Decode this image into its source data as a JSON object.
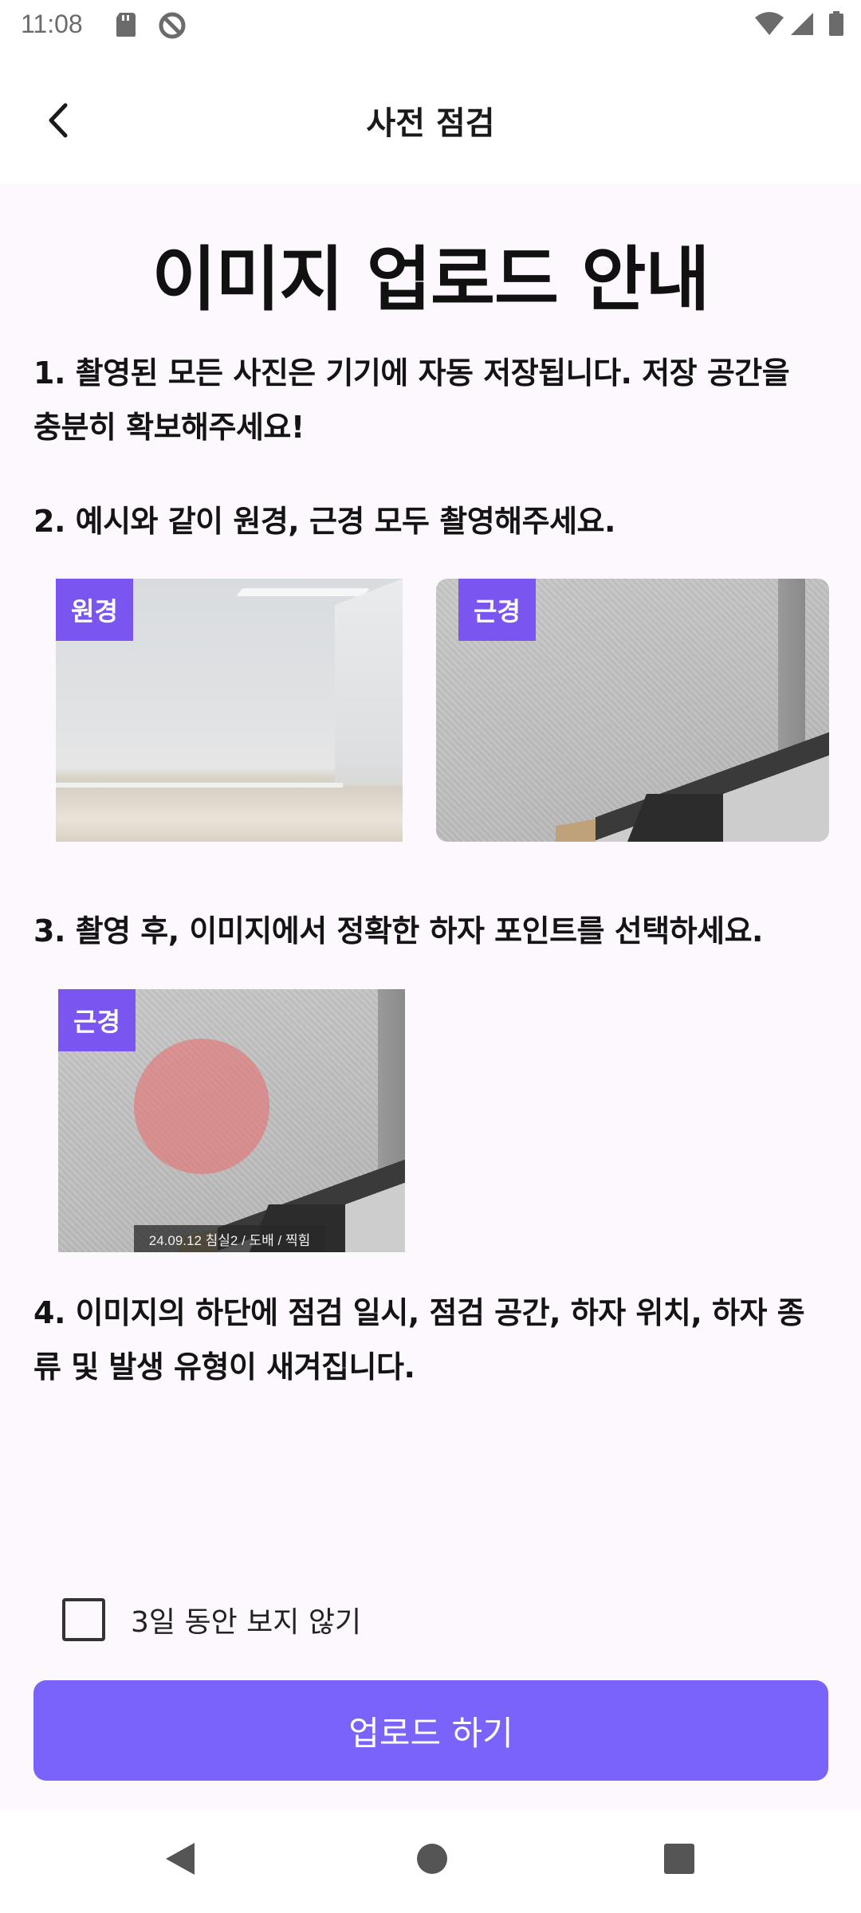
{
  "status_bar": {
    "time": "11:08",
    "icons": [
      "sd-card-icon",
      "do-not-disturb-icon",
      "wifi-icon",
      "signal-icon",
      "battery-icon"
    ]
  },
  "app_bar": {
    "title": "사전 점검",
    "back_icon": "back-arrow-icon"
  },
  "guide": {
    "title": "이미지 업로드 안내",
    "steps": [
      {
        "line1": "1. 촬영된 모든 사진은 기기에 자동 저장됩니다. 저장 공간을",
        "line2": "충분히 확보해주세요!"
      },
      {
        "line1": "2. 예시와 같이 원경, 근경 모두 촬영해주세요."
      },
      {
        "line1": "3. 촬영 후, 이미지에서 정확한 하자 포인트를 선택하세요."
      },
      {
        "line1": "4. 이미지의 하단에 점검 일시, 점검 공간, 하자 위치, 하자 종",
        "line2": "류 및 발생 유형이 새겨집니다."
      }
    ],
    "examples": {
      "far_tag": "원경",
      "near_tag": "근경",
      "point_tag": "근경",
      "stamp_text": "24.09.12 침실2 / 도배 / 찍힘"
    }
  },
  "dismiss": {
    "label": "3일 동안 보지 않기",
    "checked": false
  },
  "primary_button": {
    "label": "업로드 하기",
    "color": "#7a63fb"
  },
  "tag_color": "#7a55f0",
  "nav_bar": {
    "icons": [
      "back-triangle-icon",
      "home-circle-icon",
      "recents-square-icon"
    ]
  }
}
